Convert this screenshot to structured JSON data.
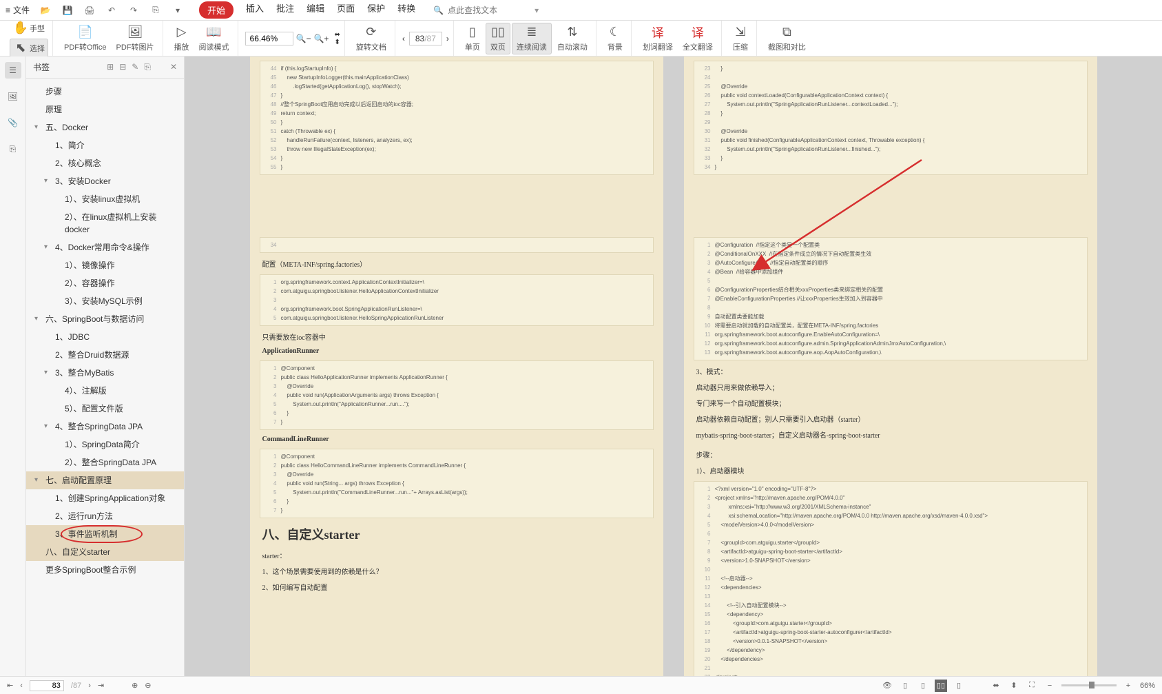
{
  "menubar": {
    "file": "文件",
    "tabs": [
      "开始",
      "插入",
      "批注",
      "编辑",
      "页面",
      "保护",
      "转换"
    ],
    "search_placeholder": "点此查找文本"
  },
  "toolbar": {
    "hand": "手型",
    "select": "选择",
    "pdf_to_office": "PDF转Office",
    "pdf_to_image": "PDF转图片",
    "play": "播放",
    "read_mode": "阅读模式",
    "zoom": "66.46%",
    "rotate": "旋转文档",
    "single_page": "单页",
    "double_page": "双页",
    "continuous": "连续阅读",
    "auto_scroll": "自动滚动",
    "background": "背景",
    "translate_word": "划词翻译",
    "translate_full": "全文翻译",
    "compress": "压缩",
    "compare": "截图和对比",
    "page_current": "83",
    "page_total": "/87"
  },
  "sidebar": {
    "title": "书签",
    "items": [
      {
        "label": "步骤",
        "level": 0
      },
      {
        "label": "原理",
        "level": 0
      },
      {
        "label": "五、Docker",
        "level": 0,
        "arrow": "▾"
      },
      {
        "label": "1、简介",
        "level": 1
      },
      {
        "label": "2、核心概念",
        "level": 1
      },
      {
        "label": "3、安装Docker",
        "level": 1,
        "arrow": "▾"
      },
      {
        "label": "1）、安装linux虚拟机",
        "level": 2
      },
      {
        "label": "2）、在linux虚拟机上安装docker",
        "level": 2
      },
      {
        "label": "4、Docker常用命令&操作",
        "level": 1,
        "arrow": "▾"
      },
      {
        "label": "1）、镜像操作",
        "level": 2
      },
      {
        "label": "2）、容器操作",
        "level": 2
      },
      {
        "label": "3）、安装MySQL示例",
        "level": 2
      },
      {
        "label": "六、SpringBoot与数据访问",
        "level": 0,
        "arrow": "▾"
      },
      {
        "label": "1、JDBC",
        "level": 1
      },
      {
        "label": "2、整合Druid数据源",
        "level": 1
      },
      {
        "label": "3、整合MyBatis",
        "level": 1,
        "arrow": "▾"
      },
      {
        "label": "4）、注解版",
        "level": 2
      },
      {
        "label": "5）、配置文件版",
        "level": 2
      },
      {
        "label": "4、整合SpringData JPA",
        "level": 1,
        "arrow": "▾"
      },
      {
        "label": "1）、SpringData简介",
        "level": 2
      },
      {
        "label": "2）、整合SpringData JPA",
        "level": 2
      },
      {
        "label": "七、启动配置原理",
        "level": 0,
        "arrow": "▾",
        "cls": "selected-parent"
      },
      {
        "label": "1、创建SpringApplication对象",
        "level": 1
      },
      {
        "label": "2、运行run方法",
        "level": 1
      },
      {
        "label": "3、事件监听机制",
        "level": 1,
        "cls": "circled selected"
      },
      {
        "label": "八、自定义starter",
        "level": 0,
        "cls": "selected"
      },
      {
        "label": "更多SpringBoot整合示例",
        "level": 0
      }
    ]
  },
  "left_page": {
    "code1": [
      {
        "n": "44",
        "t": "if (this.logStartupInfo) {"
      },
      {
        "n": "45",
        "t": "    new StartupInfoLogger(this.mainApplicationClass)"
      },
      {
        "n": "46",
        "t": "        .logStarted(getApplicationLog(), stopWatch);"
      },
      {
        "n": "47",
        "t": "}"
      },
      {
        "n": "48",
        "t": "//整个SpringBoot应用启动完成以后返回启动的ioc容器;"
      },
      {
        "n": "49",
        "t": "return context;"
      },
      {
        "n": "50",
        "t": "}"
      },
      {
        "n": "51",
        "t": "catch (Throwable ex) {"
      },
      {
        "n": "52",
        "t": "    handleRunFailure(context, listeners, analyzers, ex);"
      },
      {
        "n": "53",
        "t": "    throw new IllegalStateException(ex);"
      },
      {
        "n": "54",
        "t": "}"
      },
      {
        "n": "55",
        "t": "}"
      }
    ],
    "code2_single": "34",
    "config_title": "配置（META-INF/spring.factories）",
    "code3": [
      {
        "n": "1",
        "t": "org.springframework.context.ApplicationContextInitializer=\\"
      },
      {
        "n": "2",
        "t": "com.atguigu.springboot.listener.HelloApplicationContextInitializer"
      },
      {
        "n": "3",
        "t": ""
      },
      {
        "n": "4",
        "t": "org.springframework.boot.SpringApplicationRunListener=\\"
      },
      {
        "n": "5",
        "t": "com.atguigu.springboot.listener.HelloSpringApplicationRunListener"
      }
    ],
    "txt1": "只需要放在ioc容器中",
    "txt2": "ApplicationRunner",
    "code4": [
      {
        "n": "1",
        "t": "@Component"
      },
      {
        "n": "2",
        "t": "public class HelloApplicationRunner implements ApplicationRunner {"
      },
      {
        "n": "3",
        "t": "    @Override"
      },
      {
        "n": "4",
        "t": "    public void run(ApplicationArguments args) throws Exception {"
      },
      {
        "n": "5",
        "t": "        System.out.println(\"ApplicationRunner...run....\");"
      },
      {
        "n": "6",
        "t": "    }"
      },
      {
        "n": "7",
        "t": "}"
      }
    ],
    "txt3": "CommandLineRunner",
    "code5": [
      {
        "n": "1",
        "t": "@Component"
      },
      {
        "n": "2",
        "t": "public class HelloCommandLineRunner implements CommandLineRunner {"
      },
      {
        "n": "3",
        "t": "    @Override"
      },
      {
        "n": "4",
        "t": "    public void run(String... args) throws Exception {"
      },
      {
        "n": "5",
        "t": "        System.out.println(\"CommandLineRunner...run...\"+ Arrays.asList(args));"
      },
      {
        "n": "6",
        "t": "    }"
      },
      {
        "n": "7",
        "t": "}"
      }
    ],
    "h2": "八、自定义starter",
    "txt4": "starter：",
    "txt5": "1、这个场景需要使用到的依赖是什么？",
    "txt6": "2、如何编写自动配置"
  },
  "right_page": {
    "code1": [
      {
        "n": "23",
        "t": "    }"
      },
      {
        "n": "24",
        "t": ""
      },
      {
        "n": "25",
        "t": "    @Override"
      },
      {
        "n": "26",
        "t": "    public void contextLoaded(ConfigurableApplicationContext context) {"
      },
      {
        "n": "27",
        "t": "        System.out.println(\"SpringApplicationRunListener...contextLoaded...\");"
      },
      {
        "n": "28",
        "t": "    }"
      },
      {
        "n": "29",
        "t": ""
      },
      {
        "n": "30",
        "t": "    @Override"
      },
      {
        "n": "31",
        "t": "    public void finished(ConfigurableApplicationContext context, Throwable exception) {"
      },
      {
        "n": "32",
        "t": "        System.out.println(\"SpringApplicationRunListener...finished...\");"
      },
      {
        "n": "33",
        "t": "    }"
      },
      {
        "n": "34",
        "t": "}"
      }
    ],
    "code2": [
      {
        "n": "1",
        "t": "@Configuration  //指定这个类是一个配置类"
      },
      {
        "n": "2",
        "t": "@ConditionalOnXXX  //在指定条件成立的情况下自动配置类生效"
      },
      {
        "n": "3",
        "t": "@AutoConfigureAfter  //指定自动配置类的顺序"
      },
      {
        "n": "4",
        "t": "@Bean  //给容器中添加组件"
      },
      {
        "n": "5",
        "t": ""
      },
      {
        "n": "6",
        "t": "@ConfigurationProperties结合相关xxxProperties类来绑定相关的配置"
      },
      {
        "n": "7",
        "t": "@EnableConfigurationProperties //让xxxProperties生效加入到容器中"
      },
      {
        "n": "8",
        "t": ""
      },
      {
        "n": "9",
        "t": "自动配置类要能加载"
      },
      {
        "n": "10",
        "t": "将需要启动就加载的自动配置类，配置在META-INF/spring.factories"
      },
      {
        "n": "11",
        "t": "org.springframework.boot.autoconfigure.EnableAutoConfiguration=\\"
      },
      {
        "n": "12",
        "t": "org.springframework.boot.autoconfigure.admin.SpringApplicationAdminJmxAutoConfiguration,\\"
      },
      {
        "n": "13",
        "t": "org.springframework.boot.autoconfigure.aop.AopAutoConfiguration,\\"
      }
    ],
    "txt1": "3、模式：",
    "txt2": "启动器只用来做依赖导入；",
    "txt3": "专门来写一个自动配置模块；",
    "txt4": "启动器依赖自动配置；别人只需要引入启动器（starter）",
    "txt5": "mybatis-spring-boot-starter；自定义启动器名-spring-boot-starter",
    "txt6": "步骤：",
    "txt7": "1）、启动器模块",
    "code3": [
      {
        "n": "1",
        "t": "<?xml version=\"1.0\" encoding=\"UTF-8\"?>"
      },
      {
        "n": "2",
        "t": "<project xmlns=\"http://maven.apache.org/POM/4.0.0\""
      },
      {
        "n": "3",
        "t": "         xmlns:xsi=\"http://www.w3.org/2001/XMLSchema-instance\""
      },
      {
        "n": "4",
        "t": "         xsi:schemaLocation=\"http://maven.apache.org/POM/4.0.0 http://maven.apache.org/xsd/maven-4.0.0.xsd\">"
      },
      {
        "n": "5",
        "t": "    <modelVersion>4.0.0</modelVersion>"
      },
      {
        "n": "6",
        "t": ""
      },
      {
        "n": "7",
        "t": "    <groupId>com.atguigu.starter</groupId>"
      },
      {
        "n": "8",
        "t": "    <artifactId>atguigu-spring-boot-starter</artifactId>"
      },
      {
        "n": "9",
        "t": "    <version>1.0-SNAPSHOT</version>"
      },
      {
        "n": "10",
        "t": ""
      },
      {
        "n": "11",
        "t": "    <!--启动器-->"
      },
      {
        "n": "12",
        "t": "    <dependencies>"
      },
      {
        "n": "13",
        "t": ""
      },
      {
        "n": "14",
        "t": "        <!--引入自动配置模块-->"
      },
      {
        "n": "15",
        "t": "        <dependency>"
      },
      {
        "n": "16",
        "t": "            <groupId>com.atguigu.starter</groupId>"
      },
      {
        "n": "17",
        "t": "            <artifactId>atguigu-spring-boot-starter-autoconfigurer</artifactId>"
      },
      {
        "n": "18",
        "t": "            <version>0.0.1-SNAPSHOT</version>"
      },
      {
        "n": "19",
        "t": "        </dependency>"
      },
      {
        "n": "20",
        "t": "    </dependencies>"
      },
      {
        "n": "21",
        "t": ""
      },
      {
        "n": "22",
        "t": "</project>"
      }
    ]
  },
  "statusbar": {
    "page_current": "83",
    "page_total": "/87",
    "zoom": "66%"
  }
}
